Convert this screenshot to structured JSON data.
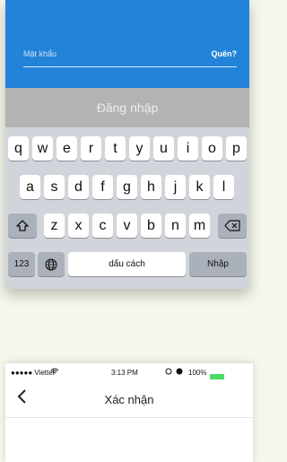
{
  "login": {
    "password_placeholder": "Mật khẩu",
    "forgot_label": "Quên?",
    "submit_label": "Đăng nhập"
  },
  "keyboard": {
    "row1": [
      "q",
      "w",
      "e",
      "r",
      "t",
      "y",
      "u",
      "i",
      "o",
      "p"
    ],
    "row2": [
      "a",
      "s",
      "d",
      "f",
      "g",
      "h",
      "j",
      "k",
      "l"
    ],
    "row3": [
      "z",
      "x",
      "c",
      "v",
      "b",
      "n",
      "m"
    ],
    "numbers_label": "123",
    "space_label": "dấu cách",
    "return_label": "Nhập",
    "icons": {
      "shift": "shift-icon",
      "delete": "backspace-icon",
      "globe": "globe-icon"
    }
  },
  "status_bar": {
    "carrier": "●●●●● Viettel",
    "time": "3:13 PM",
    "battery": "100%",
    "battery_color": "#4cd964"
  },
  "confirm_screen": {
    "title": "Xác nhận"
  },
  "colors": {
    "brand_blue": "#2383d8",
    "disabled_button": "#b3b3b3",
    "keyboard_bg": "#d1d5db"
  }
}
